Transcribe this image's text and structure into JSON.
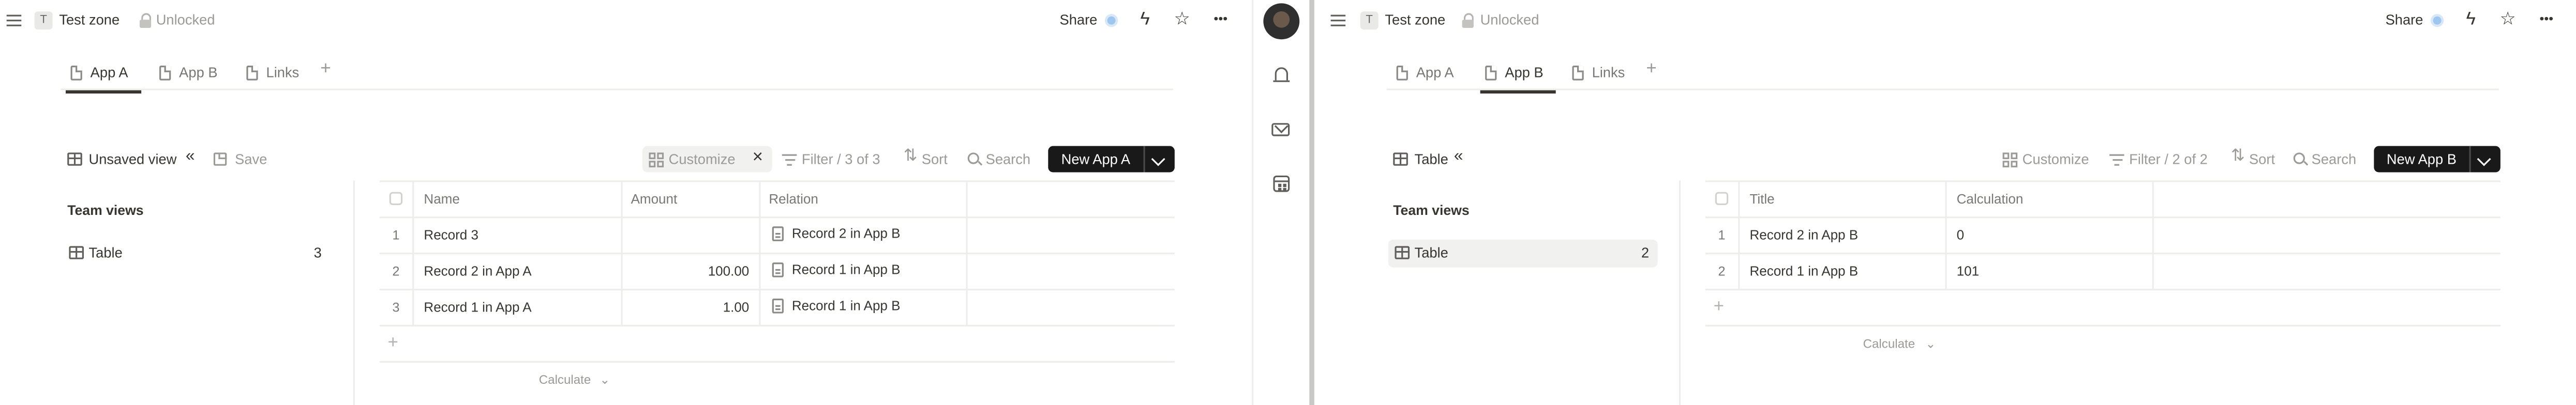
{
  "left": {
    "breadcrumb": {
      "workspace_initial": "T",
      "title": "Test zone",
      "lock_label": "Unlocked"
    },
    "topbar": {
      "share_label": "Share",
      "more": "•••"
    },
    "tabs": [
      {
        "label": "App A",
        "active": true
      },
      {
        "label": "App B",
        "active": false
      },
      {
        "label": "Links",
        "active": false
      }
    ],
    "toolbar": {
      "view_name": "Unsaved view",
      "collapse": "«",
      "save_label": "Save",
      "customize_label": "Customize",
      "clear_glyph": "×",
      "filter_label": "Filter / 3 of 3",
      "sort_label": "Sort",
      "search_label": "Search",
      "new_label": "New App A"
    },
    "sidebar": {
      "heading": "Team views",
      "view_label": "Table",
      "view_count": "3"
    },
    "table": {
      "headers": [
        "Name",
        "Amount",
        "Relation"
      ],
      "rows": [
        {
          "num": "1",
          "name": "Record 3",
          "amount": "",
          "relation": "Record 2 in App B"
        },
        {
          "num": "2",
          "name": "Record 2 in App A",
          "amount": "100.00",
          "relation": "Record 1 in App B"
        },
        {
          "num": "3",
          "name": "Record 1 in App A",
          "amount": "1.00",
          "relation": "Record 1 in App B"
        }
      ],
      "calculate_label": "Calculate"
    }
  },
  "right": {
    "breadcrumb": {
      "workspace_initial": "T",
      "title": "Test zone",
      "lock_label": "Unlocked"
    },
    "topbar": {
      "share_label": "Share",
      "more": "•••"
    },
    "tabs": [
      {
        "label": "App A",
        "active": false
      },
      {
        "label": "App B",
        "active": true
      },
      {
        "label": "Links",
        "active": false
      }
    ],
    "toolbar": {
      "view_name": "Table",
      "collapse": "«",
      "customize_label": "Customize",
      "filter_label": "Filter / 2 of 2",
      "sort_label": "Sort",
      "search_label": "Search",
      "new_label": "New App B"
    },
    "sidebar": {
      "heading": "Team views",
      "view_label": "Table",
      "view_count": "2"
    },
    "table": {
      "headers": [
        "Title",
        "Calculation"
      ],
      "rows": [
        {
          "num": "1",
          "title": "Record 2 in App B",
          "calculation": "0"
        },
        {
          "num": "2",
          "title": "Record 1 in App B",
          "calculation": "101"
        }
      ],
      "calculate_label": "Calculate"
    }
  },
  "glyphs": {
    "star": "☆",
    "bolt": "ϟ",
    "plus": "+",
    "chevron": "⌄"
  },
  "colors": {
    "accent_button": "#191919",
    "text": "#37352f",
    "muted": "#9b9a97",
    "border": "#ededeb"
  }
}
